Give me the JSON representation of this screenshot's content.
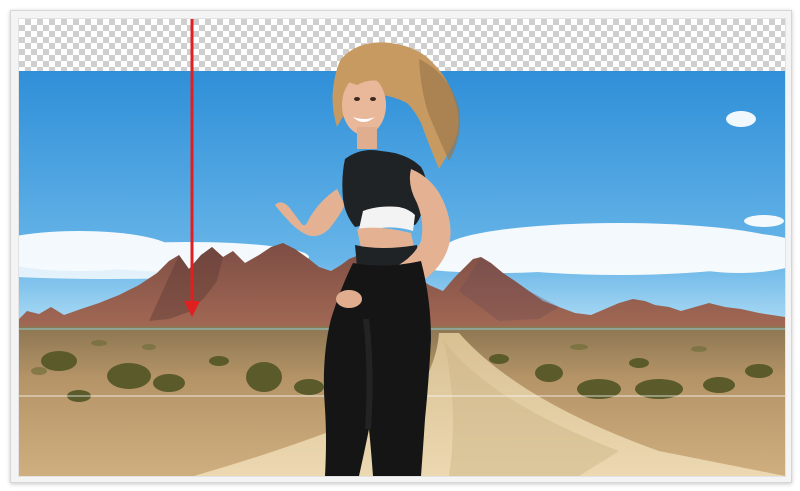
{
  "document": {
    "transparent_area": "checkerboard",
    "layers": [
      "background-photo",
      "model-cutout"
    ]
  },
  "annotations": {
    "arrow_color": "#e02020",
    "horizon_guide_color": "#8fd0d8",
    "lower_guide_color": "#ffffff"
  },
  "colors": {
    "sky_top": "#2f8fd8",
    "sky_bottom": "#8ccbef",
    "mountain": "#8b5a4c",
    "ground": "#caa574",
    "road": "#e6cfa2",
    "top_garment": "#1f2326",
    "leggings": "#141414",
    "hair": "#c9a068"
  }
}
